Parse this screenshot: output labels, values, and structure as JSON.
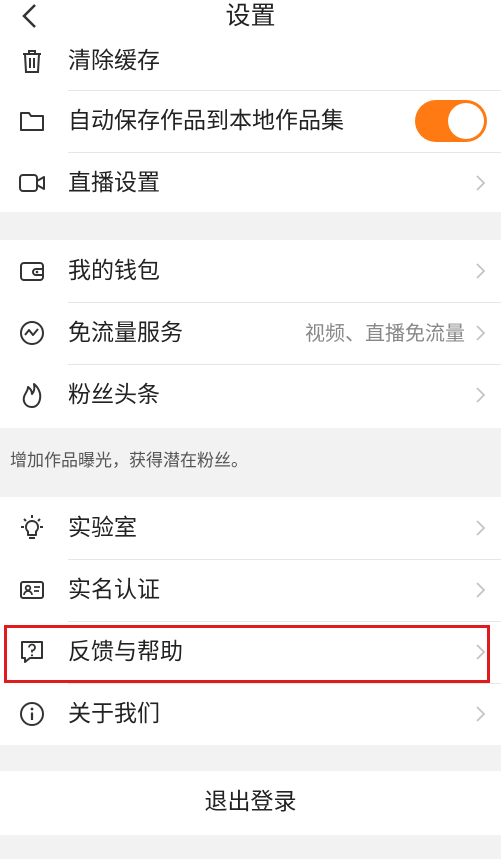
{
  "header": {
    "title": "设置"
  },
  "section1": {
    "items": [
      {
        "label": "清除缓存",
        "icon": "trash-icon"
      },
      {
        "label": "自动保存作品到本地作品集",
        "icon": "folder-icon",
        "toggle_on": true
      },
      {
        "label": "直播设置",
        "icon": "video-camera-icon"
      }
    ]
  },
  "section2": {
    "items": [
      {
        "label": "我的钱包",
        "icon": "wallet-icon"
      },
      {
        "label": "免流量服务",
        "icon": "trend-icon",
        "sub": "视频、直播免流量"
      },
      {
        "label": "粉丝头条",
        "icon": "flame-icon"
      }
    ],
    "note": "增加作品曝光，获得潜在粉丝。"
  },
  "section3": {
    "items": [
      {
        "label": "实验室",
        "icon": "lightbulb-icon"
      },
      {
        "label": "实名认证",
        "icon": "id-card-icon"
      },
      {
        "label": "反馈与帮助",
        "icon": "help-chat-icon"
      },
      {
        "label": "关于我们",
        "icon": "info-icon"
      }
    ]
  },
  "logout": {
    "label": "退出登录"
  },
  "colors": {
    "accent": "#ff7a12",
    "highlight": "#e01b1b"
  }
}
